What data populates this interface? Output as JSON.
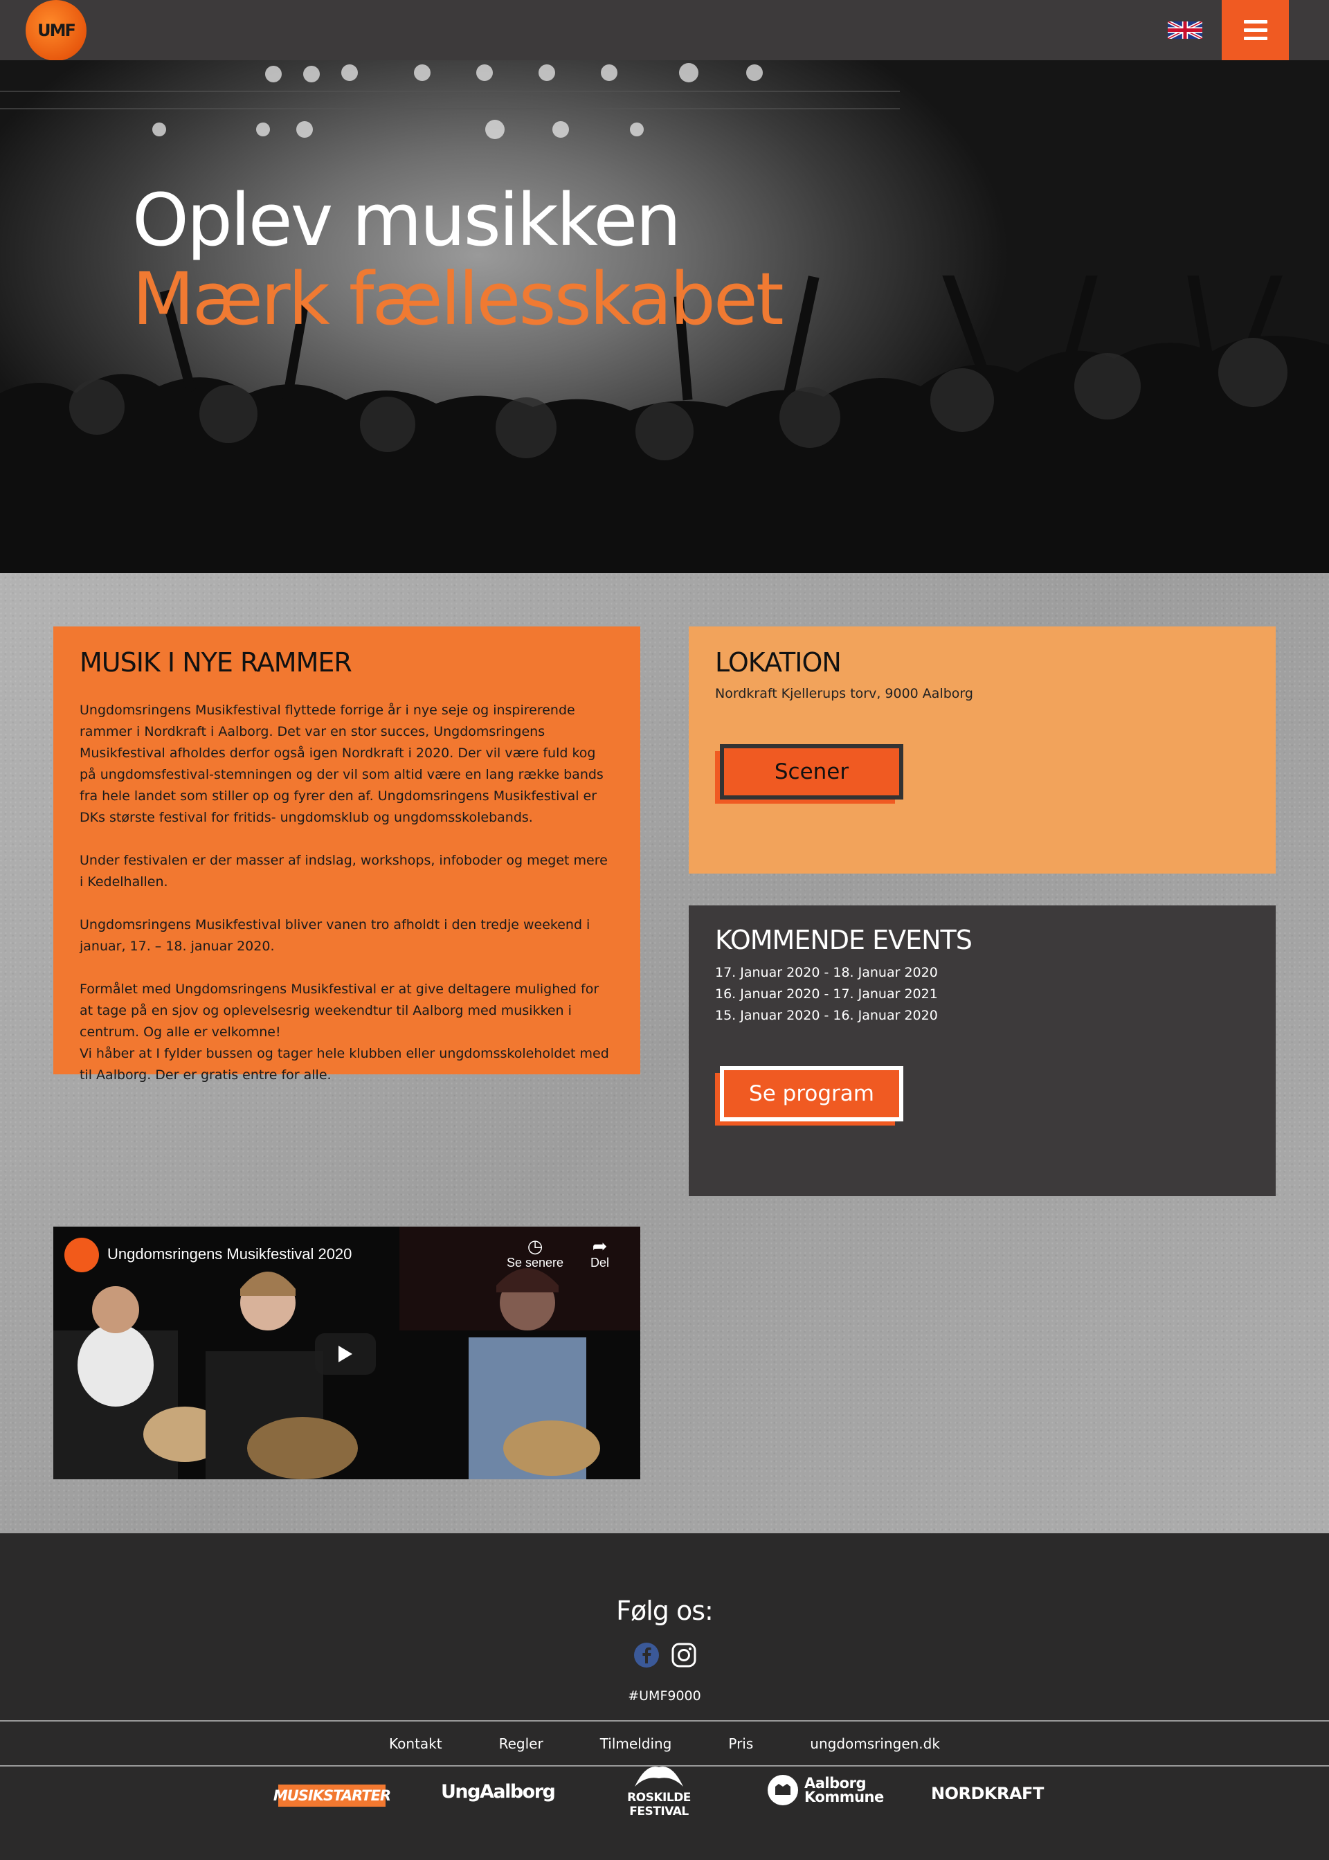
{
  "header": {
    "logo_text": "UMF",
    "language_icon": "uk-flag-icon",
    "menu_icon": "hamburger-menu-icon",
    "accent_color": "#f05a22"
  },
  "hero": {
    "line1": "Oplev musikken",
    "line2": "Mærk fællesskabet"
  },
  "about": {
    "title": "MUSIK I NYE RAMMER",
    "paragraphs": [
      "Ungdomsringens Musikfestival flyttede forrige år i nye seje og inspirerende rammer i Nordkraft i Aalborg. Det var en stor succes, Ungdomsringens Musikfestival afholdes derfor også igen Nordkraft i 2020. Der vil være fuld kog på ungdomsfestival-stemningen og der vil som altid være en lang række bands fra hele landet som stiller op og fyrer den af. Ungdomsringens Musikfestival er DKs største festival for fritids- ungdomsklub og ungdomsskolebands.",
      "Under festivalen er der masser af indslag, workshops, infoboder og meget mere i Kedelhallen.",
      "Ungdomsringens Musikfestival bliver vanen tro afholdt i den tredje weekend i januar, 17. – 18. januar 2020.",
      "Formålet med Ungdomsringens Musikfestival er at give deltagere mulighed for at tage på en sjov og oplevelsesrig weekendtur til Aalborg med musikken i centrum. Og alle er velkomne!\nVi håber at I fylder bussen og tager hele klubben eller ungdomsskoleholdet med til Aalborg. Der er gratis entre for alle."
    ],
    "bg_color": "#f27830"
  },
  "location": {
    "title": "LOKATION",
    "address": "Nordkraft Kjellerups torv, 9000 Aalborg",
    "button_label": "Scener",
    "bg_color": "#f2a35b"
  },
  "events": {
    "title": "KOMMENDE EVENTS",
    "items": [
      "17. Januar 2020 - 18. Januar 2020",
      "16. Januar 2020 - 17. Januar 2021",
      "15. Januar 2020 - 16. Januar 2020"
    ],
    "button_label": "Se program",
    "bg_color": "#3d3a3b"
  },
  "video": {
    "title": "Ungdomsringens Musikfestival 2020",
    "watch_later": "Se senere",
    "share": "Del"
  },
  "footer": {
    "follow": "Følg os:",
    "hashtag": "#UMF9000",
    "social_icons": [
      "facebook-icon",
      "instagram-icon"
    ],
    "links": [
      "Kontakt",
      "Regler",
      "Tilmelding",
      "Pris",
      "ungdomsringen.dk"
    ],
    "sponsors": [
      "MUSIKSTARTER",
      "UngAalborg",
      "ROSKILDE FESTIVAL",
      "Aalborg Kommune",
      "NORDKRAFT"
    ]
  }
}
